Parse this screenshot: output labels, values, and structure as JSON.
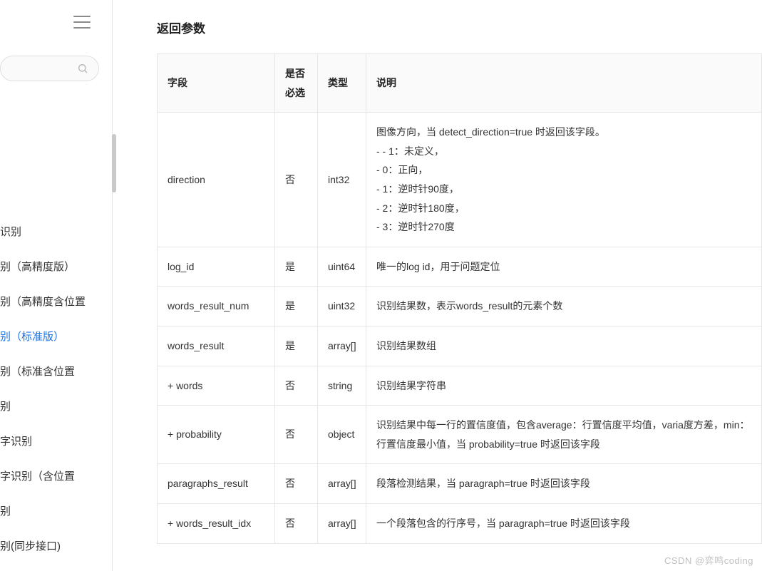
{
  "section_title": "返回参数",
  "watermark": "CSDN @弈鸣coding",
  "sidebar": {
    "items": [
      {
        "label": "识别"
      },
      {
        "label": "别（高精度版）"
      },
      {
        "label": "别（高精度含位置"
      },
      {
        "label": "别（标准版）",
        "active": true
      },
      {
        "label": "别（标准含位置"
      },
      {
        "label": "别"
      },
      {
        "label": "字识别"
      },
      {
        "label": "字识别（含位置"
      },
      {
        "label": "别"
      },
      {
        "label": "别(同步接口)"
      }
    ]
  },
  "table": {
    "headers": {
      "field": "字段",
      "required": "是否必选",
      "type": "类型",
      "desc": "说明"
    },
    "rows": [
      {
        "field": "direction",
        "required": "否",
        "type": "int32",
        "desc": [
          "图像方向，当 detect_direction=true 时返回该字段。",
          "- - 1：未定义，",
          "- 0：正向，",
          "- 1：逆时针90度，",
          "- 2：逆时针180度，",
          "- 3：逆时针270度"
        ]
      },
      {
        "field": "log_id",
        "required": "是",
        "type": "uint64",
        "desc": [
          "唯一的log id，用于问题定位"
        ]
      },
      {
        "field": "words_result_num",
        "required": "是",
        "type": "uint32",
        "desc": [
          "识别结果数，表示words_result的元素个数"
        ]
      },
      {
        "field": "words_result",
        "required": "是",
        "type": "array[]",
        "desc": [
          "识别结果数组"
        ]
      },
      {
        "field": "+ words",
        "required": "否",
        "type": "string",
        "desc": [
          "识别结果字符串"
        ]
      },
      {
        "field": "+ probability",
        "required": "否",
        "type": "object",
        "desc": [
          "识别结果中每一行的置信度值，包含average：行置信度平均值，varia度方差，min：行置信度最小值，当 probability=true 时返回该字段"
        ]
      },
      {
        "field": "paragraphs_result",
        "required": "否",
        "type": "array[]",
        "desc": [
          "段落检测结果，当 paragraph=true 时返回该字段"
        ]
      },
      {
        "field": "+ words_result_idx",
        "required": "否",
        "type": "array[]",
        "desc": [
          "一个段落包含的行序号，当 paragraph=true 时返回该字段"
        ]
      }
    ]
  }
}
